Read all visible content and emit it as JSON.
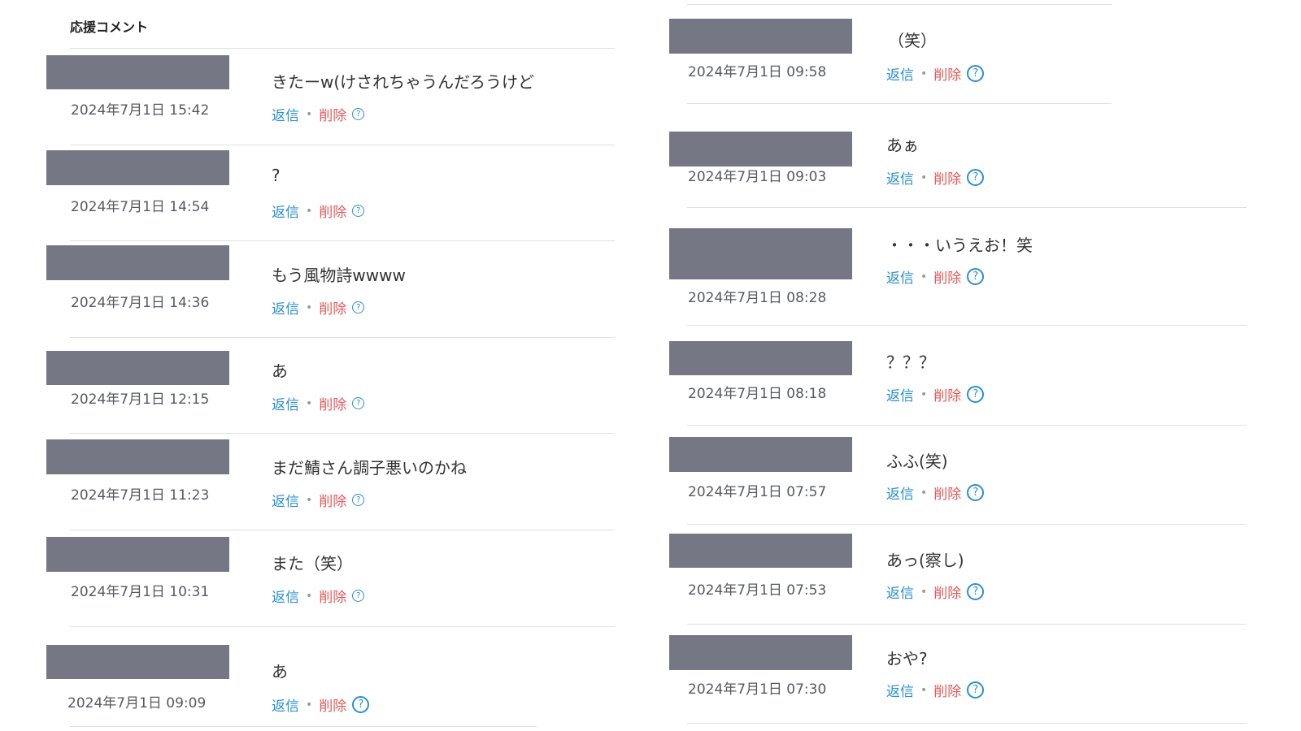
{
  "heading": "応援コメント",
  "actions": {
    "reply": "返信",
    "separator": "•",
    "delete": "削除",
    "help_glyph": "?"
  },
  "left_comments": [
    {
      "text": "きたーw(けされちゃうんだろうけど",
      "date": "2024年7月1日 15:42"
    },
    {
      "text": "?",
      "date": "2024年7月1日 14:54"
    },
    {
      "text": "もう風物詩wwww",
      "date": "2024年7月1日 14:36"
    },
    {
      "text": "あ",
      "date": "2024年7月1日 12:15"
    },
    {
      "text": "まだ鯖さん調子悪いのかね",
      "date": "2024年7月1日 11:23"
    },
    {
      "text": "また（笑）",
      "date": "2024年7月1日 10:31"
    },
    {
      "text": "あ",
      "date": "2024年7月1日 09:09"
    }
  ],
  "right_comments": [
    {
      "text": "（笑）",
      "date": "2024年7月1日 09:58"
    },
    {
      "text": "あぁ",
      "date": "2024年7月1日 09:03"
    },
    {
      "text": "・・・いうえお！笑",
      "date": "2024年7月1日 08:28"
    },
    {
      "text": "？？？",
      "date": "2024年7月1日 08:18"
    },
    {
      "text": "ふふ(笑)",
      "date": "2024年7月1日 07:57"
    },
    {
      "text": "あっ(察し)",
      "date": "2024年7月1日 07:53"
    },
    {
      "text": "おや?",
      "date": "2024年7月1日 07:30"
    }
  ]
}
